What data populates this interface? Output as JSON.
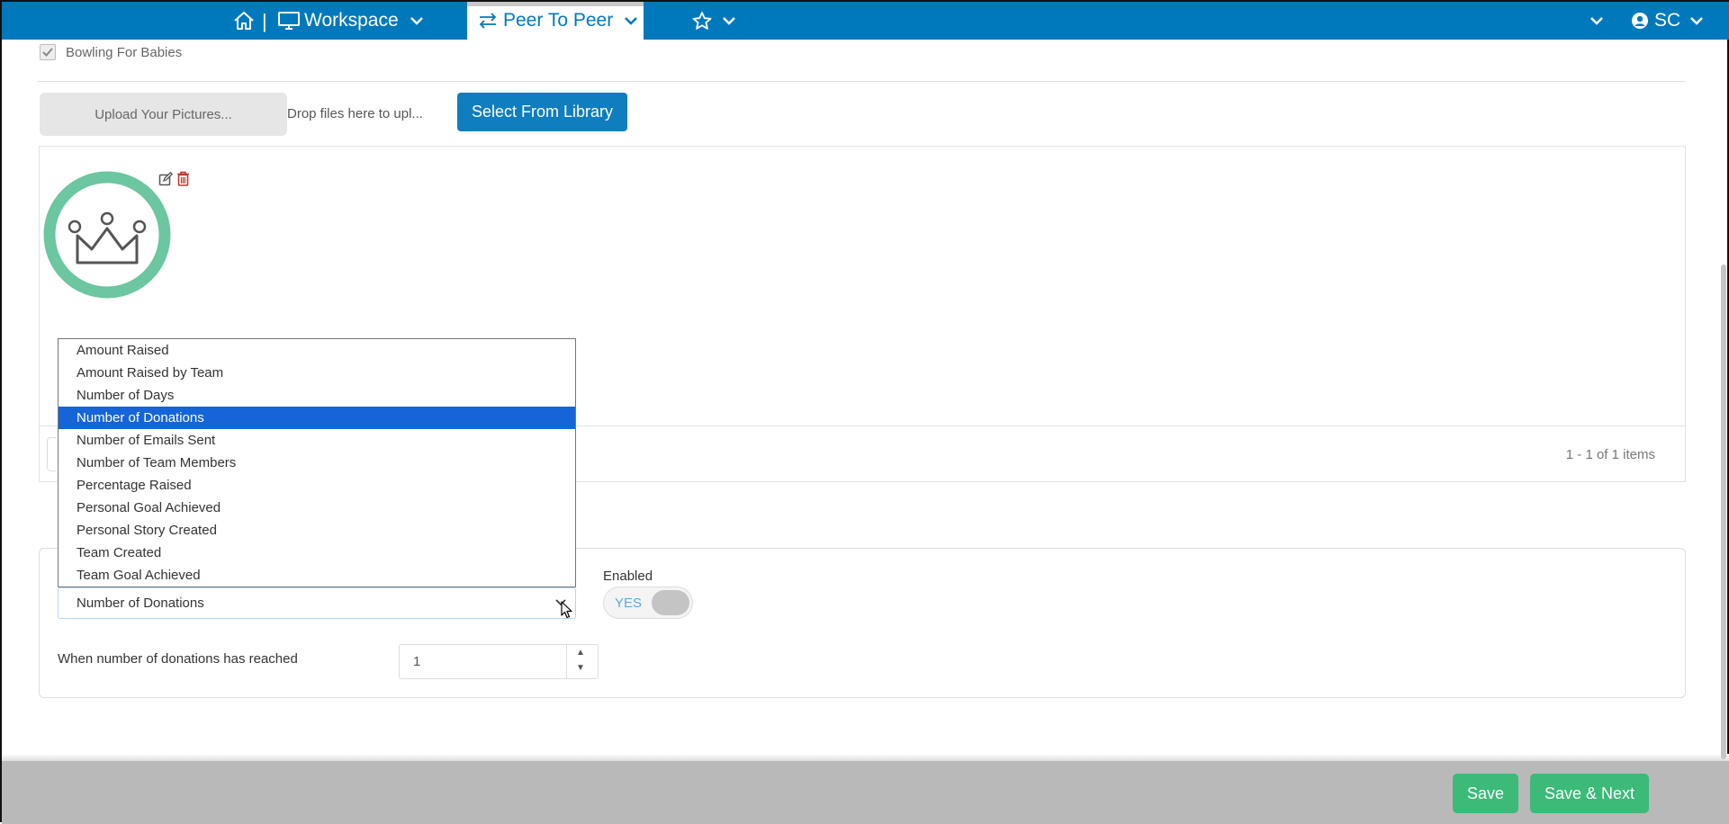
{
  "nav": {
    "workspace": "Workspace",
    "peer_to_peer": "Peer To Peer",
    "separator": "|",
    "user_initials": "SC"
  },
  "checkbox_label": "Bowling For Babies",
  "upload": {
    "button": "Upload Your Pictures...",
    "drop_text": "Drop files here to upl...",
    "library_button": "Select From Library"
  },
  "gallery": {
    "pager": "1 - 1 of 1 items"
  },
  "rule": {
    "selected": "Number of Donations",
    "options": [
      "Amount Raised",
      "Amount Raised by Team",
      "Number of Days",
      "Number of Donations",
      "Number of Emails Sent",
      "Number of Team Members",
      "Percentage Raised",
      "Personal Goal Achieved",
      "Personal Story Created",
      "Team Created",
      "Team Goal Achieved"
    ],
    "enabled_label": "Enabled",
    "toggle_text": "YES",
    "threshold_label": "When number of donations has reached",
    "threshold_value": "1"
  },
  "footer": {
    "save": "Save",
    "save_next": "Save & Next"
  },
  "colors": {
    "nav_bg": "#0079bc",
    "primary_button": "#0f7dbe",
    "save_button": "#3bba78",
    "badge_ring": "#6cc6a0",
    "dropdown_highlight": "#1565d8"
  }
}
